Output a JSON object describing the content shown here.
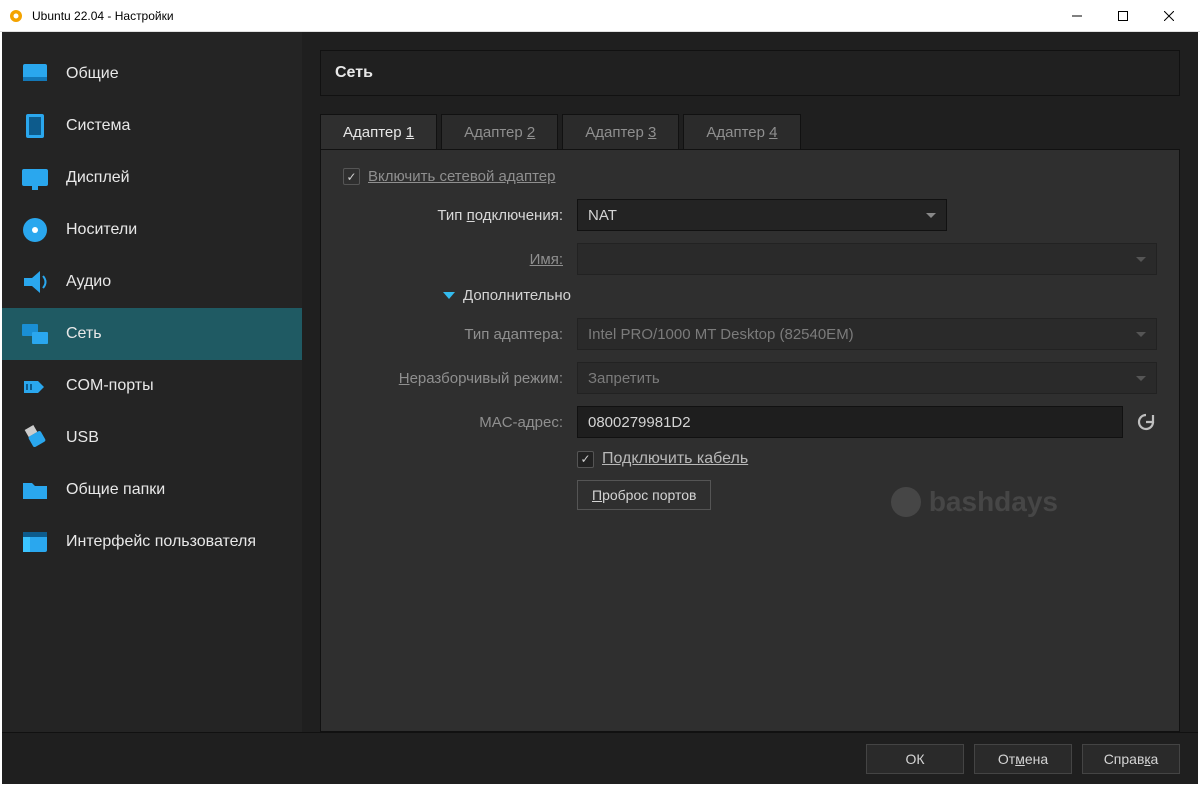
{
  "title": "Ubuntu 22.04 - Настройки",
  "sidebar": {
    "items": [
      {
        "label": "Общие"
      },
      {
        "label": "Система"
      },
      {
        "label": "Дисплей"
      },
      {
        "label": "Носители"
      },
      {
        "label": "Аудио"
      },
      {
        "label": "Сеть",
        "selected": true
      },
      {
        "label": "COM-порты"
      },
      {
        "label": "USB"
      },
      {
        "label": "Общие папки"
      },
      {
        "label": "Интерфейс пользователя"
      }
    ]
  },
  "panel_title": "Сеть",
  "tabs": [
    {
      "label_pre": "Адаптер ",
      "label_num": "1",
      "active": true
    },
    {
      "label_pre": "Адаптер ",
      "label_num": "2"
    },
    {
      "label_pre": "Адаптер ",
      "label_num": "3"
    },
    {
      "label_pre": "Адаптер ",
      "label_num": "4"
    }
  ],
  "enable_adapter_label": "Включить сетевой адаптер",
  "form": {
    "attached_label_pre": "Тип ",
    "attached_label_ul": "п",
    "attached_label_post": "одключения:",
    "attached_value": "NAT",
    "name_label": "Имя:",
    "name_value": "",
    "advanced_label_pre": "",
    "advanced_label_ul": "Д",
    "advanced_label_post": "ополнительно",
    "adapter_type_label": "Тип адаптера:",
    "adapter_type_value": "Intel PRO/1000 MT Desktop (82540EM)",
    "promisc_label_pre": "",
    "promisc_label_ul": "Н",
    "promisc_label_post": "еразборчивый режим:",
    "promisc_value": "Запретить",
    "mac_label": "MAC-адрес:",
    "mac_value": "0800279981D2",
    "cable_label": "Подключить кабель",
    "port_forward_btn_pre": "",
    "port_forward_btn_ul": "П",
    "port_forward_btn_post": "роброс портов"
  },
  "footer": {
    "ok": "ОК",
    "cancel_pre": "От",
    "cancel_ul": "м",
    "cancel_post": "ена",
    "help_pre": "Справ",
    "help_ul": "к",
    "help_post": "а"
  },
  "watermark": "bashdays"
}
